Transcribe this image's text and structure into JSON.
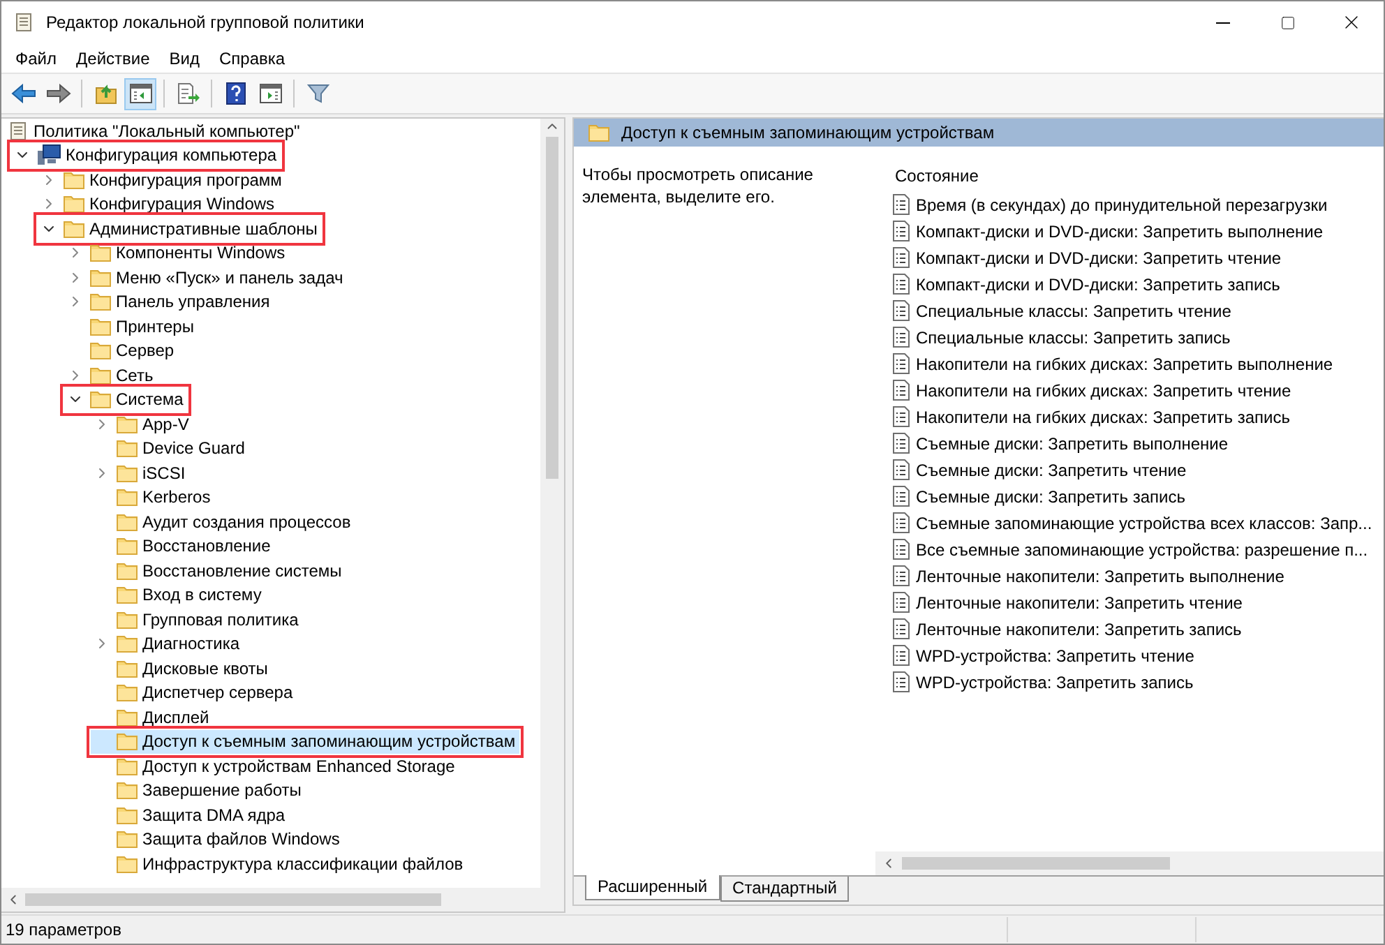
{
  "window": {
    "title": "Редактор локальной групповой политики"
  },
  "menu": [
    "Файл",
    "Действие",
    "Вид",
    "Справка"
  ],
  "toolbar": [
    [
      {
        "kind": "back",
        "pressed": false
      },
      {
        "kind": "forward",
        "pressed": false
      }
    ],
    [
      {
        "kind": "up",
        "pressed": false
      },
      {
        "kind": "tree-toggle",
        "pressed": true
      }
    ],
    [
      {
        "kind": "export",
        "pressed": false
      }
    ],
    [
      {
        "kind": "help",
        "pressed": false
      },
      {
        "kind": "action-pane",
        "pressed": false
      }
    ],
    [
      {
        "kind": "filter",
        "pressed": false
      }
    ]
  ],
  "tree_root": {
    "label": "Политика \"Локальный компьютер\""
  },
  "tree": [
    {
      "label": "Конфигурация компьютера",
      "kind": "computer",
      "has_children": true,
      "expanded": true,
      "selected": false,
      "highlighted": true,
      "children": [
        {
          "label": "Конфигурация программ",
          "kind": "folder",
          "has_children": true,
          "expanded": false,
          "selected": false,
          "highlighted": false
        },
        {
          "label": "Конфигурация Windows",
          "kind": "folder",
          "has_children": true,
          "expanded": false,
          "selected": false,
          "highlighted": false
        },
        {
          "label": "Административные шаблоны",
          "kind": "folder",
          "has_children": true,
          "expanded": true,
          "selected": false,
          "highlighted": true,
          "children": [
            {
              "label": "Компоненты Windows",
              "kind": "folder",
              "has_children": true,
              "expanded": false,
              "selected": false,
              "highlighted": false
            },
            {
              "label": "Меню «Пуск» и панель задач",
              "kind": "folder",
              "has_children": true,
              "expanded": false,
              "selected": false,
              "highlighted": false
            },
            {
              "label": "Панель управления",
              "kind": "folder",
              "has_children": true,
              "expanded": false,
              "selected": false,
              "highlighted": false
            },
            {
              "label": "Принтеры",
              "kind": "folder",
              "has_children": false,
              "expanded": false,
              "selected": false,
              "highlighted": false
            },
            {
              "label": "Сервер",
              "kind": "folder",
              "has_children": false,
              "expanded": false,
              "selected": false,
              "highlighted": false
            },
            {
              "label": "Сеть",
              "kind": "folder",
              "has_children": true,
              "expanded": false,
              "selected": false,
              "highlighted": false
            },
            {
              "label": "Система",
              "kind": "folder",
              "has_children": true,
              "expanded": true,
              "selected": false,
              "highlighted": true,
              "children": [
                {
                  "label": "App-V",
                  "kind": "folder",
                  "has_children": true,
                  "expanded": false,
                  "selected": false,
                  "highlighted": false
                },
                {
                  "label": "Device Guard",
                  "kind": "folder",
                  "has_children": false,
                  "expanded": false,
                  "selected": false,
                  "highlighted": false
                },
                {
                  "label": "iSCSI",
                  "kind": "folder",
                  "has_children": true,
                  "expanded": false,
                  "selected": false,
                  "highlighted": false
                },
                {
                  "label": "Kerberos",
                  "kind": "folder",
                  "has_children": false,
                  "expanded": false,
                  "selected": false,
                  "highlighted": false
                },
                {
                  "label": "Аудит создания процессов",
                  "kind": "folder",
                  "has_children": false,
                  "expanded": false,
                  "selected": false,
                  "highlighted": false
                },
                {
                  "label": "Восстановление",
                  "kind": "folder",
                  "has_children": false,
                  "expanded": false,
                  "selected": false,
                  "highlighted": false
                },
                {
                  "label": "Восстановление системы",
                  "kind": "folder",
                  "has_children": false,
                  "expanded": false,
                  "selected": false,
                  "highlighted": false
                },
                {
                  "label": "Вход в систему",
                  "kind": "folder",
                  "has_children": false,
                  "expanded": false,
                  "selected": false,
                  "highlighted": false
                },
                {
                  "label": "Групповая политика",
                  "kind": "folder",
                  "has_children": false,
                  "expanded": false,
                  "selected": false,
                  "highlighted": false
                },
                {
                  "label": "Диагностика",
                  "kind": "folder",
                  "has_children": true,
                  "expanded": false,
                  "selected": false,
                  "highlighted": false
                },
                {
                  "label": "Дисковые квоты",
                  "kind": "folder",
                  "has_children": false,
                  "expanded": false,
                  "selected": false,
                  "highlighted": false
                },
                {
                  "label": "Диспетчер сервера",
                  "kind": "folder",
                  "has_children": false,
                  "expanded": false,
                  "selected": false,
                  "highlighted": false
                },
                {
                  "label": "Дисплей",
                  "kind": "folder",
                  "has_children": false,
                  "expanded": false,
                  "selected": false,
                  "highlighted": false
                },
                {
                  "label": "Доступ к съемным запоминающим устройствам",
                  "kind": "folder",
                  "has_children": false,
                  "expanded": false,
                  "selected": true,
                  "highlighted": true
                },
                {
                  "label": "Доступ к устройствам Enhanced Storage",
                  "kind": "folder",
                  "has_children": false,
                  "expanded": false,
                  "selected": false,
                  "highlighted": false
                },
                {
                  "label": "Завершение работы",
                  "kind": "folder",
                  "has_children": false,
                  "expanded": false,
                  "selected": false,
                  "highlighted": false
                },
                {
                  "label": "Защита DMA ядра",
                  "kind": "folder",
                  "has_children": false,
                  "expanded": false,
                  "selected": false,
                  "highlighted": false
                },
                {
                  "label": "Защита файлов Windows",
                  "kind": "folder",
                  "has_children": false,
                  "expanded": false,
                  "selected": false,
                  "highlighted": false
                },
                {
                  "label": "Инфраструктура классификации файлов",
                  "kind": "folder",
                  "has_children": false,
                  "expanded": false,
                  "selected": false,
                  "highlighted": false
                }
              ]
            }
          ]
        }
      ]
    }
  ],
  "details": {
    "header": "Доступ к съемным запоминающим устройствам",
    "description": "Чтобы просмотреть описание элемента, выделите его.",
    "column": "Состояние",
    "settings": [
      {
        "label": "Время (в секундах) до принудительной перезагрузки",
        "selected": false
      },
      {
        "label": "Компакт-диски и DVD-диски: Запретить выполнение",
        "selected": false
      },
      {
        "label": "Компакт-диски и DVD-диски: Запретить чтение",
        "selected": false
      },
      {
        "label": "Компакт-диски и DVD-диски: Запретить запись",
        "selected": false
      },
      {
        "label": "Специальные классы: Запретить чтение",
        "selected": false
      },
      {
        "label": "Специальные классы: Запретить запись",
        "selected": false
      },
      {
        "label": "Накопители на гибких дисках: Запретить выполнение",
        "selected": false
      },
      {
        "label": "Накопители на гибких дисках: Запретить чтение",
        "selected": false
      },
      {
        "label": "Накопители на гибких дисках: Запретить запись",
        "selected": false
      },
      {
        "label": "Съемные диски: Запретить выполнение",
        "selected": false
      },
      {
        "label": "Съемные диски: Запретить чтение",
        "selected": false
      },
      {
        "label": "Съемные диски: Запретить запись",
        "selected": false
      },
      {
        "label": "Съемные запоминающие устройства всех классов: Запр...",
        "selected": false
      },
      {
        "label": "Все съемные запоминающие устройства: разрешение п...",
        "selected": false
      },
      {
        "label": "Ленточные накопители: Запретить выполнение",
        "selected": false
      },
      {
        "label": "Ленточные накопители: Запретить чтение",
        "selected": false
      },
      {
        "label": "Ленточные накопители: Запретить запись",
        "selected": false
      },
      {
        "label": "WPD-устройства: Запретить чтение",
        "selected": false
      },
      {
        "label": "WPD-устройства: Запретить запись",
        "selected": false
      }
    ]
  },
  "tabs": [
    {
      "label": "Расширенный",
      "selected": true
    },
    {
      "label": "Стандартный",
      "selected": false
    }
  ],
  "status_bar": {
    "text": "19 параметров"
  }
}
